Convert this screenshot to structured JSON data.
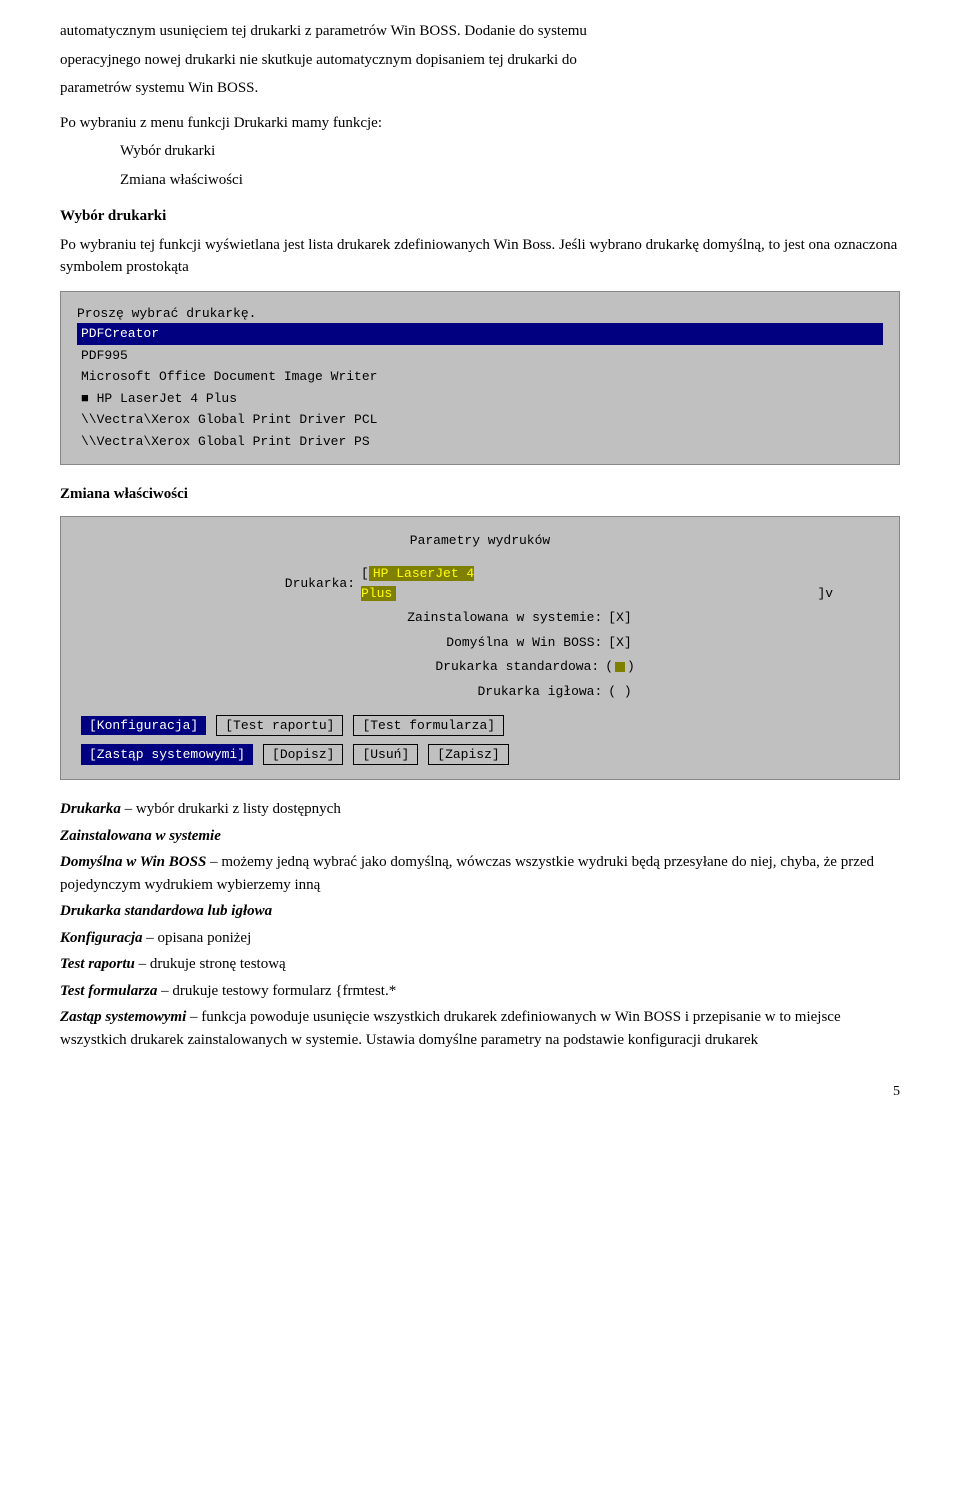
{
  "intro": {
    "line1": "automatycznym usunięciem tej drukarki z parametrów Win BOSS. Dodanie do systemu",
    "line2": "operacyjnego nowej drukarki nie skutkuje automatycznym dopisaniem tej drukarki do",
    "line3": "parametrów systemu Win BOSS."
  },
  "menu_section": {
    "intro": "Po wybraniu z menu funkcji Drukarki mamy funkcje:",
    "item1": "Wybór drukarki",
    "item2": "Zmiana właściwości"
  },
  "wybor_section": {
    "heading": "Wybór drukarki",
    "desc": "Po wybraniu tej funkcji wyświetlana jest lista drukarek zdefiniowanych  Win Boss. Jeśli wybrano drukarkę domyślną, to jest ona oznaczona symbolem prostokąta"
  },
  "terminal1": {
    "title": "Proszę wybrać drukarkę.",
    "rows": [
      {
        "text": "PDFCreator",
        "style": "selected-blue"
      },
      {
        "text": "PDF995",
        "style": "normal"
      },
      {
        "text": "Microsoft Office Document Image Writer",
        "style": "normal"
      },
      {
        "text": "HP LaserJet 4 Plus",
        "style": "normal",
        "bullet": true
      },
      {
        "text": "\\\\Vectra\\Xerox Global Print Driver PCL",
        "style": "normal"
      },
      {
        "text": "\\\\Vectra\\Xerox Global Print Driver PS",
        "style": "normal"
      }
    ]
  },
  "zmiana_section": {
    "heading": "Zmiana właściwości"
  },
  "params_box": {
    "title": "Parametry wydruków",
    "rows": [
      {
        "label": "Drukarka:",
        "value": "HP LaserJet 4 Plus",
        "style": "highlight-yellow",
        "suffix": "]v"
      },
      {
        "label": "Zainstalowana w systemie:",
        "value": "[X]",
        "style": "normal"
      },
      {
        "label": "Domyślna w Win BOSS:",
        "value": "[X]",
        "style": "normal"
      },
      {
        "label": "Drukarka standardowa:",
        "value": "square",
        "style": "square"
      },
      {
        "label": "Drukarka igłowa:",
        "value": "( )",
        "style": "normal"
      }
    ],
    "buttons_row1": [
      {
        "label": "[Konfiguracja]",
        "active": true
      },
      {
        "label": "[Test raportu]",
        "active": false
      },
      {
        "label": "[Test formularza]",
        "active": false
      }
    ],
    "buttons_row2": [
      {
        "label": "[Zastąp systemowymi]",
        "active": true
      },
      {
        "label": "[Dopisz]",
        "active": false
      },
      {
        "label": "[Usuń]",
        "active": false
      },
      {
        "label": "[Zapisz]",
        "active": false
      }
    ]
  },
  "description": {
    "line1_bold": "Drukarka",
    "line1_rest": " – wybór drukarki z listy dostępnych",
    "line2_bold": "Zainstalowana w systemie",
    "line2_rest": "",
    "line3_bold": "Domyślna w Win BOSS",
    "line3_rest": " – możemy jedną wybrać jako domyślną, wówczas wszystkie wydruki będą przesyłane do niej, chyba, że przed pojedynczym wydrukiem wybierzemy inną",
    "line4_bold": "Drukarka standardowa lub igłowa",
    "line4_rest": "",
    "line5_bold": "Konfiguracja",
    "line5_rest": " – opisana poniżej",
    "line6_bold": "Test raportu",
    "line6_rest": " – drukuje stronę testową",
    "line7_bold": "Test formularza",
    "line7_rest": " – drukuje testowy formularz {frmtest.*",
    "line8_bold": "Zastąp systemowymi",
    "line8_rest": " – funkcja powoduje usunięcie wszystkich drukarek zdefiniowanych w Win BOSS i przepisanie w to miejsce wszystkich drukarek zainstalowanych w systemie. Ustawia domyślne parametry na podstawie konfiguracji drukarek"
  },
  "page_number": "5"
}
